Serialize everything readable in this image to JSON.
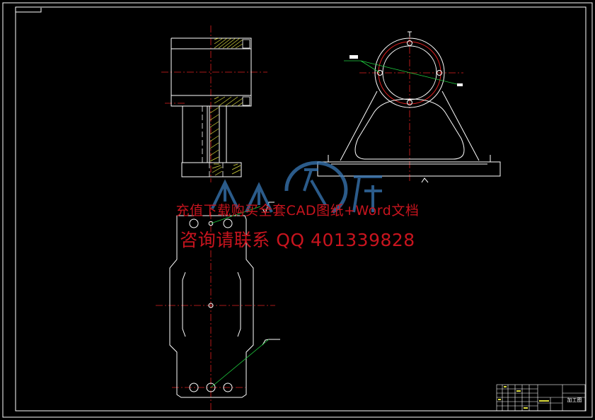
{
  "watermark": {
    "line1": "充值下载购买全套CAD图纸+Word文档",
    "line2": "咨询请联系  QQ 401339828",
    "logo_text": "人人文库"
  },
  "title_block": {
    "part_name": "加工图"
  },
  "colors": {
    "background": "#000000",
    "outline": "#ffffff",
    "centerline": "#e02020",
    "leader": "#20d040",
    "hatch": "#e0e040",
    "watermark": "#c8141e",
    "logo": "#3a7ab8"
  }
}
